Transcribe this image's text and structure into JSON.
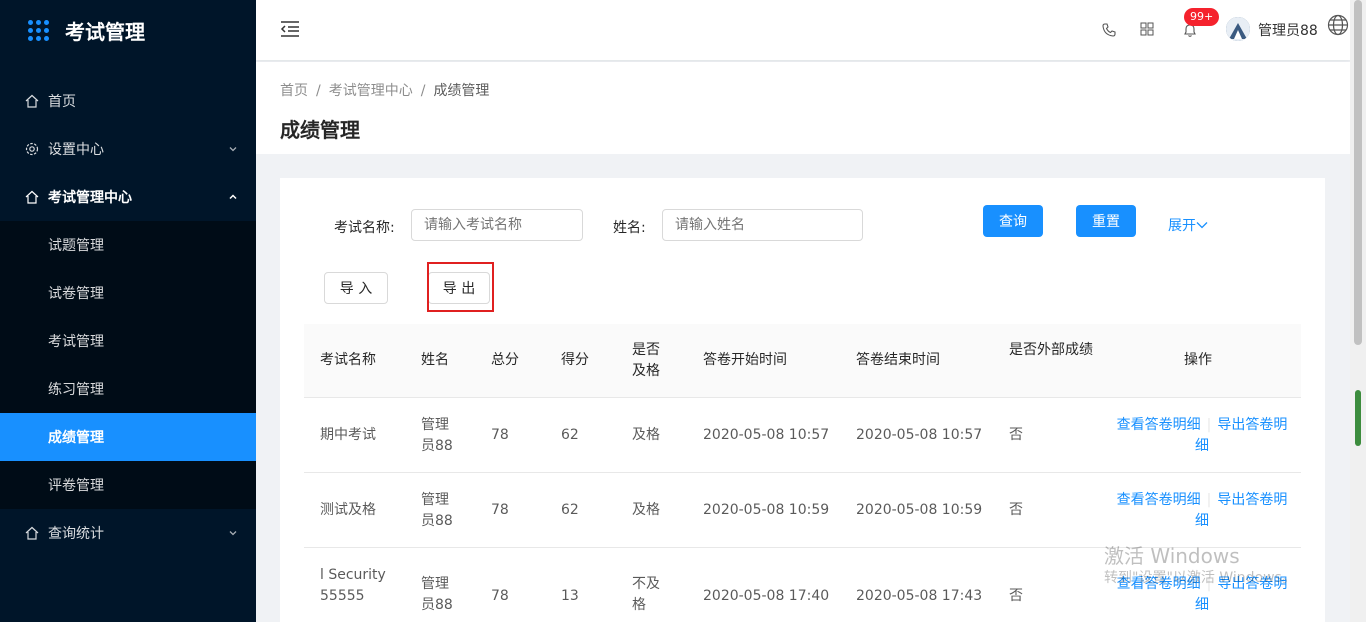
{
  "app": {
    "title": "考试管理"
  },
  "sidebar": {
    "items": [
      {
        "label": "首页"
      },
      {
        "label": "设置中心"
      },
      {
        "label": "考试管理中心"
      },
      {
        "label": "查询统计"
      }
    ],
    "subitems": [
      {
        "label": "试题管理"
      },
      {
        "label": "试卷管理"
      },
      {
        "label": "考试管理"
      },
      {
        "label": "练习管理"
      },
      {
        "label": "成绩管理"
      },
      {
        "label": "评卷管理"
      }
    ]
  },
  "header": {
    "badge": "99+",
    "username": "管理员88"
  },
  "breadcrumb": {
    "items": [
      "首页",
      "考试管理中心",
      "成绩管理"
    ]
  },
  "page": {
    "title": "成绩管理"
  },
  "search": {
    "exam_label": "考试名称:",
    "exam_placeholder": "请输入考试名称",
    "name_label": "姓名:",
    "name_placeholder": "请输入姓名",
    "query_label": "查询",
    "reset_label": "重置",
    "expand_label": "展开"
  },
  "toolbar": {
    "import_label": "导 入",
    "export_label": "导 出"
  },
  "table": {
    "headers": [
      "考试名称",
      "姓名",
      "总分",
      "得分",
      "是否及格",
      "答卷开始时间",
      "答卷结束时间",
      "是否外部成绩",
      "操作"
    ],
    "rows": [
      {
        "exam": "期中考试",
        "name": "管理员88",
        "total": "78",
        "score": "62",
        "pass": "及格",
        "start": "2020-05-08 10:57",
        "end": "2020-05-08 10:57",
        "external": "否",
        "op_view": "查看答卷明细",
        "op_export": "导出答卷明细"
      },
      {
        "exam": "测试及格",
        "name": "管理员88",
        "total": "78",
        "score": "62",
        "pass": "及格",
        "start": "2020-05-08 10:59",
        "end": "2020-05-08 10:59",
        "external": "否",
        "op_view": "查看答卷明细",
        "op_export": "导出答卷明细"
      },
      {
        "exam": "l Security55555",
        "name": "管理员88",
        "total": "78",
        "score": "13",
        "pass": "不及格",
        "start": "2020-05-08 17:40",
        "end": "2020-05-08 17:43",
        "external": "否",
        "op_view": "查看答卷明细",
        "op_export": "导出答卷明细"
      }
    ]
  },
  "watermark": {
    "line1": "激活 Windows",
    "line2": "转到\"设置\"以激活 Windows。"
  },
  "colors": {
    "primary": "#1890ff",
    "sidebar": "#001529",
    "active": "#1890ff",
    "highlight": "#e02020"
  }
}
